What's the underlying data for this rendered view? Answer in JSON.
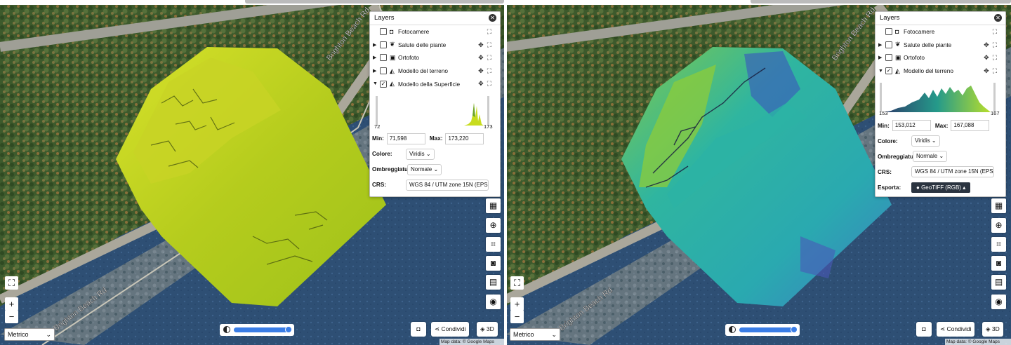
{
  "panes": [
    {
      "layers_title": "Layers",
      "layers": [
        {
          "label": "Fotocamere",
          "icon": "camera-icon",
          "caret": "",
          "checked": false,
          "move": false
        },
        {
          "label": "Salute delle piante",
          "icon": "plant-icon",
          "caret": "▶",
          "checked": false,
          "move": true
        },
        {
          "label": "Ortofoto",
          "icon": "image-icon",
          "caret": "▶",
          "checked": false,
          "move": true
        },
        {
          "label": "Modello del terreno",
          "icon": "terrain-icon",
          "caret": "▶",
          "checked": false,
          "move": true
        },
        {
          "label": "Modello della Superficie",
          "icon": "terrain-icon",
          "caret": "▼",
          "checked": true,
          "move": true
        }
      ],
      "histogram": {
        "min_label": "72",
        "max_label": "173"
      },
      "min_label": "Min:",
      "min_value": "71,598",
      "max_label": "Max:",
      "max_value": "173,220",
      "color_label": "Colore:",
      "color_value": "Viridis",
      "shading_label": "Ombreggiatu",
      "shading_value": "Normale",
      "crs_label": "CRS:",
      "crs_value": "WGS 84 / UTM zone 15N (EPS"
    },
    {
      "layers_title": "Layers",
      "layers": [
        {
          "label": "Fotocamere",
          "icon": "camera-icon",
          "caret": "",
          "checked": false,
          "move": false
        },
        {
          "label": "Salute delle piante",
          "icon": "plant-icon",
          "caret": "▶",
          "checked": false,
          "move": true
        },
        {
          "label": "Ortofoto",
          "icon": "image-icon",
          "caret": "▶",
          "checked": false,
          "move": true
        },
        {
          "label": "Modello del terreno",
          "icon": "terrain-icon",
          "caret": "▼",
          "checked": true,
          "move": true
        }
      ],
      "histogram": {
        "min_label": "153",
        "max_label": "167"
      },
      "min_label": "Min:",
      "min_value": "153,012",
      "max_label": "Max:",
      "max_value": "167,088",
      "color_label": "Colore:",
      "color_value": "Viridis",
      "shading_label": "Ombreggiatu",
      "shading_value": "Normale",
      "crs_label": "CRS:",
      "crs_value": "WGS 84 / UTM zone 15N (EPS",
      "export_label": "Esporta:",
      "export_value": "GeoTIFF (RGB)"
    }
  ],
  "map": {
    "road_label": "Brighton Beach Rd",
    "units_value": "Metrico",
    "zoom_in": "+",
    "zoom_out": "−",
    "opacity": 1.0,
    "share_label": "Condividi",
    "three_d_label": "3D",
    "credit": "Map data: © Google Maps"
  }
}
